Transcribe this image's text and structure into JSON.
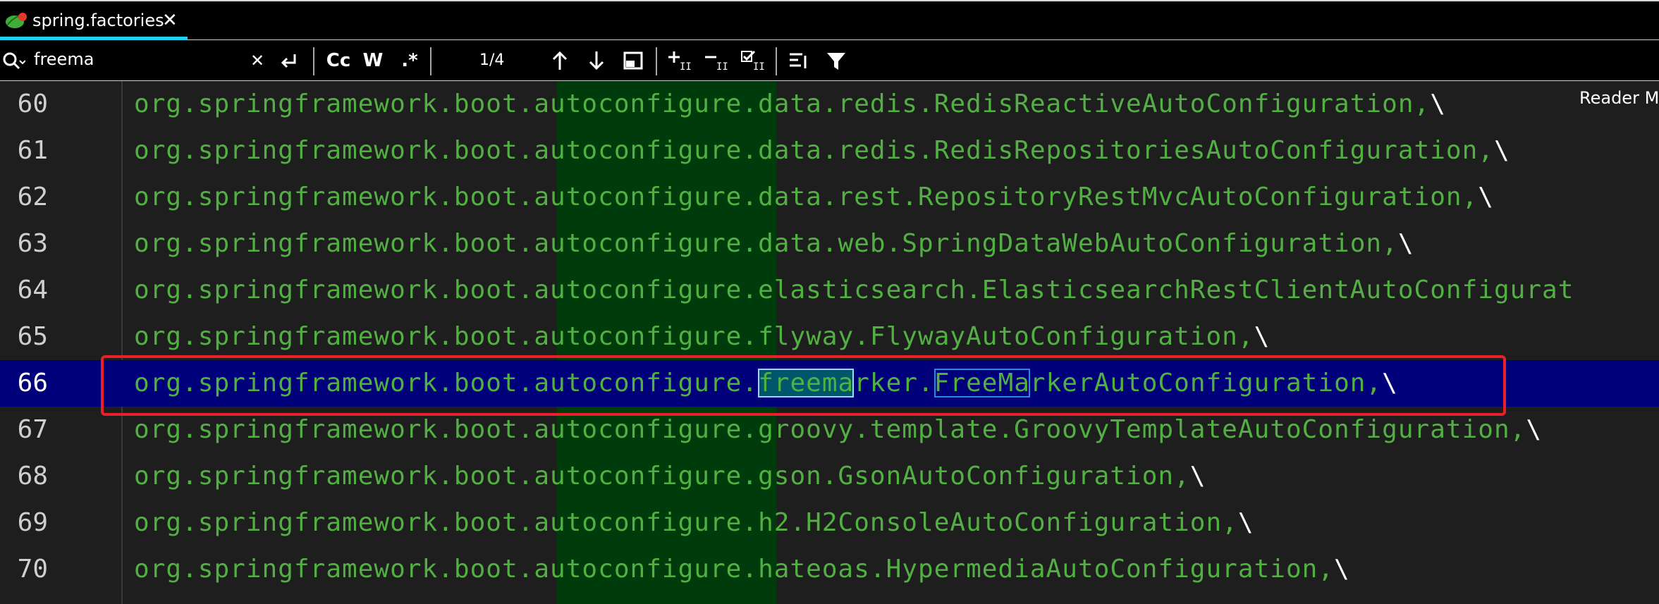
{
  "tab": {
    "label": "spring.factories",
    "close_glyph": "✕",
    "icon": "spring-leaf-icon",
    "accent": "#1ad3f0"
  },
  "search": {
    "value": "freema",
    "placeholder": "",
    "clear_glyph": "✕",
    "match_case_label": "Cc",
    "words_label": "W",
    "regex_label": ".*",
    "count": "1/4"
  },
  "editor": {
    "reader_mode_label": "Reader M",
    "line_numbers": [
      "60",
      "61",
      "62",
      "63",
      "64",
      "65",
      "66",
      "67",
      "68",
      "69",
      "70"
    ],
    "current_line": "66",
    "lines": [
      {
        "pre": "org.springframework.boot.autoconfigure.",
        "rest": "data.redis.RedisReactiveAutoConfiguration,",
        "bs": "\\"
      },
      {
        "pre": "org.springframework.boot.autoconfigure.",
        "rest": "data.redis.RedisRepositoriesAutoConfiguration,",
        "bs": "\\"
      },
      {
        "pre": "org.springframework.boot.autoconfigure.",
        "rest": "data.rest.RepositoryRestMvcAutoConfiguration,",
        "bs": "\\"
      },
      {
        "pre": "org.springframework.boot.autoconfigure.",
        "rest": "data.web.SpringDataWebAutoConfiguration,",
        "bs": "\\"
      },
      {
        "pre": "org.springframework.boot.autoconfigure.",
        "rest": "elasticsearch.ElasticsearchRestClientAutoConfigurat",
        "bs": ""
      },
      {
        "pre": "org.springframework.boot.autoconfigure.",
        "rest": "flyway.FlywayAutoConfiguration,",
        "bs": "\\"
      },
      {
        "pre": "org.springframework.boot.autoconfigure.",
        "m1": "freema",
        "mid": "rker.",
        "m2": "FreeMa",
        "rest": "rkerAutoConfiguration,",
        "bs": "\\"
      },
      {
        "pre": "org.springframework.boot.autoconfigure.",
        "rest": "groovy.template.GroovyTemplateAutoConfiguration,",
        "bs": "\\"
      },
      {
        "pre": "org.springframework.boot.autoconfigure.",
        "rest": "gson.GsonAutoConfiguration,",
        "bs": "\\"
      },
      {
        "pre": "org.springframework.boot.autoconfigure.",
        "rest": "h2.H2ConsoleAutoConfiguration,",
        "bs": "\\"
      },
      {
        "pre": "org.springframework.boot.autoconfigure.",
        "rest": "hateoas.HypermediaAutoConfiguration,",
        "bs": "\\"
      }
    ]
  },
  "colors": {
    "code_text": "#52b043",
    "current_line_bg": "#00007a",
    "column_highlight": "#003c0b",
    "annotation_box": "#e8202a"
  }
}
